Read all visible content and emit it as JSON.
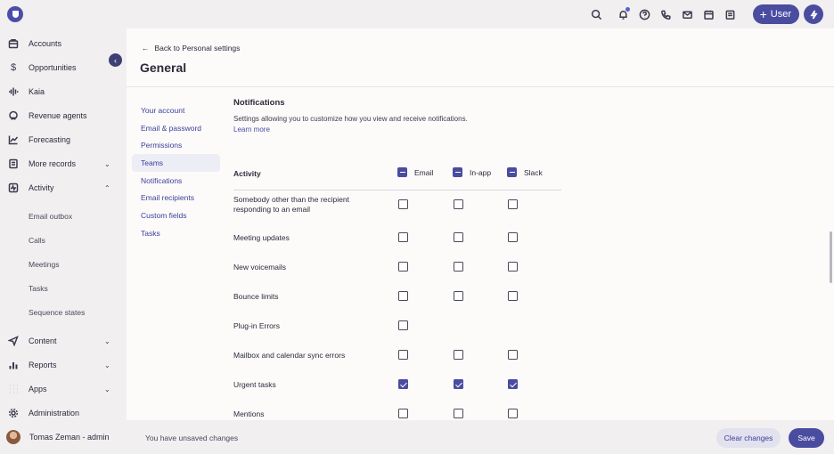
{
  "topbar": {
    "icons": [
      "search-icon",
      "bell-icon",
      "help-icon",
      "phone-icon",
      "mail-icon",
      "calendar-icon",
      "notes-icon"
    ],
    "user_button_label": "User",
    "accent": "#4a4ca0"
  },
  "sidebar": {
    "items": [
      {
        "label": "Accounts",
        "icon": "building-icon"
      },
      {
        "label": "Opportunities",
        "icon": "dollar-icon"
      },
      {
        "label": "Kaia",
        "icon": "waveform-icon"
      },
      {
        "label": "Revenue agents",
        "icon": "agent-icon"
      },
      {
        "label": "Forecasting",
        "icon": "trend-icon"
      },
      {
        "label": "More records",
        "icon": "records-icon"
      },
      {
        "label": "Activity",
        "icon": "activity-icon"
      }
    ],
    "activity_sub": [
      "Email outbox",
      "Calls",
      "Meetings",
      "Tasks",
      "Sequence states"
    ],
    "items_bottom": [
      {
        "label": "Content",
        "icon": "send-icon"
      },
      {
        "label": "Reports",
        "icon": "bar-chart-icon"
      },
      {
        "label": "Apps",
        "icon": "grid-icon"
      },
      {
        "label": "Administration",
        "icon": "gear-icon"
      }
    ],
    "user_name": "Tomas Zeman - admin"
  },
  "header": {
    "back_label": "Back to Personal settings",
    "title": "General"
  },
  "subnav": [
    "Your account",
    "Email & password",
    "Permissions",
    "Teams",
    "Notifications",
    "Email recipients",
    "Custom fields",
    "Tasks"
  ],
  "notifications": {
    "title": "Notifications",
    "description": "Settings allowing you to customize how you view and receive notifications.",
    "learn_more": "Learn more",
    "columns": {
      "activity": "Activity",
      "email": "Email",
      "inapp": "In-app",
      "slack": "Slack"
    },
    "rows": [
      {
        "label": "Somebody other than the recipient responding to an email",
        "email": false,
        "inapp": false,
        "slack": false
      },
      {
        "label": "Meeting updates",
        "email": false,
        "inapp": false,
        "slack": false
      },
      {
        "label": "New voicemails",
        "email": false,
        "inapp": false,
        "slack": false
      },
      {
        "label": "Bounce limits",
        "email": false,
        "inapp": false,
        "slack": false
      },
      {
        "label": "Plug-in Errors",
        "email": false,
        "inapp": null,
        "slack": null
      },
      {
        "label": "Mailbox and calendar sync errors",
        "email": false,
        "inapp": false,
        "slack": false
      },
      {
        "label": "Urgent tasks",
        "email": true,
        "inapp": true,
        "slack": true
      },
      {
        "label": "Mentions",
        "email": false,
        "inapp": false,
        "slack": false
      }
    ]
  },
  "footer": {
    "unsaved_text": "You have unsaved changes",
    "clear_label": "Clear changes",
    "save_label": "Save"
  }
}
